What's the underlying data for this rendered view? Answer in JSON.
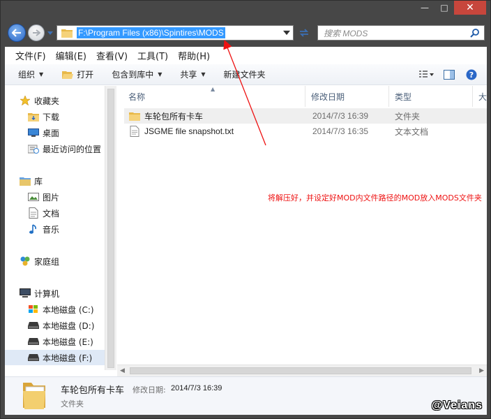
{
  "window": {
    "controls": {
      "minimize": "—",
      "maximize": "□",
      "close": "✕"
    }
  },
  "address_bar": {
    "path": "F:\\Program Files (x86)\\Spintires\\MODS",
    "search_placeholder": "搜索 MODS"
  },
  "menu": [
    "文件(F)",
    "编辑(E)",
    "查看(V)",
    "工具(T)",
    "帮助(H)"
  ],
  "toolbar": {
    "organize": "组织",
    "open": "打开",
    "include_in_library": "包含到库中",
    "share": "共享",
    "new_folder": "新建文件夹"
  },
  "nav": {
    "favorites": "收藏夹",
    "downloads": "下载",
    "desktop": "桌面",
    "recent": "最近访问的位置",
    "libraries": "库",
    "pictures": "图片",
    "documents": "文档",
    "music": "音乐",
    "homegroup": "家庭组",
    "computer": "计算机",
    "drive_c": "本地磁盘 (C:)",
    "drive_d": "本地磁盘 (D:)",
    "drive_e": "本地磁盘 (E:)",
    "drive_f": "本地磁盘 (F:)"
  },
  "columns": {
    "name": "名称",
    "date": "修改日期",
    "type": "类型",
    "size": "大"
  },
  "files": [
    {
      "name": "车轮包所有卡车",
      "date": "2014/7/3 16:39",
      "type": "文件夹",
      "icon": "folder-icon"
    },
    {
      "name": "JSGME file snapshot.txt",
      "date": "2014/7/3 16:35",
      "type": "文本文档",
      "icon": "text-file-icon"
    }
  ],
  "annotation": "将解压好，并设定好MOD内文件路径的MOD放入MODS文件夹",
  "colors": {
    "annotation": "#ee1111",
    "selection": "#3399ff",
    "close_button": "#c7463c"
  },
  "details": {
    "name": "车轮包所有卡车",
    "date_label": "修改日期:",
    "date": "2014/7/3 16:39",
    "type": "文件夹"
  },
  "watermark": "@Veians"
}
